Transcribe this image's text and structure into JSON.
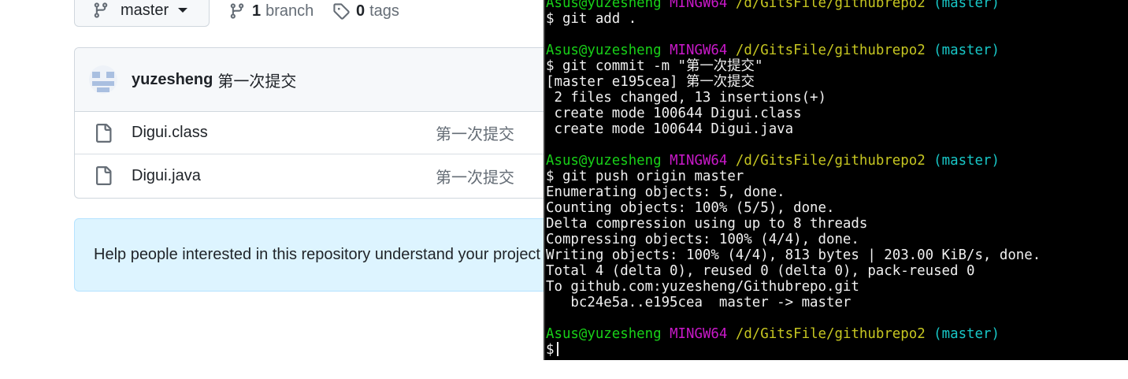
{
  "repo": {
    "branch_selector": {
      "label": "master",
      "icon": "git-branch-icon"
    },
    "branches": {
      "count": "1",
      "label": "branch",
      "icon": "git-branch-icon"
    },
    "tags": {
      "count": "0",
      "label": "tags",
      "icon": "tag-icon"
    },
    "latest_commit": {
      "author": "yuzesheng",
      "message": "第一次提交"
    },
    "files": [
      {
        "name": "Digui.class",
        "commit_message": "第一次提交",
        "icon": "file-icon"
      },
      {
        "name": "Digui.java",
        "commit_message": "第一次提交",
        "icon": "file-icon"
      }
    ],
    "readme_banner": {
      "text": "Help people interested in this repository understand your project"
    }
  },
  "terminal": {
    "colors": {
      "user": "#18d118",
      "shell": "#c919c9",
      "path": "#c6c621",
      "branch": "#18c6c6",
      "text": "#f0f0f0",
      "background": "#000000"
    },
    "prompt": {
      "user": "Asus@yuzesheng",
      "shell": "MINGW64",
      "path": "/d/GitsFile/githubrepo2",
      "branch": "(master)"
    },
    "lines": [
      {
        "kind": "prompt"
      },
      {
        "kind": "text",
        "text": "$ git add ."
      },
      {
        "kind": "text",
        "text": ""
      },
      {
        "kind": "prompt"
      },
      {
        "kind": "text",
        "text": "$ git commit -m \"第一次提交\""
      },
      {
        "kind": "text",
        "text": "[master e195cea] 第一次提交"
      },
      {
        "kind": "text",
        "text": " 2 files changed, 13 insertions(+)"
      },
      {
        "kind": "text",
        "text": " create mode 100644 Digui.class"
      },
      {
        "kind": "text",
        "text": " create mode 100644 Digui.java"
      },
      {
        "kind": "text",
        "text": ""
      },
      {
        "kind": "prompt"
      },
      {
        "kind": "text",
        "text": "$ git push origin master"
      },
      {
        "kind": "text",
        "text": "Enumerating objects: 5, done."
      },
      {
        "kind": "text",
        "text": "Counting objects: 100% (5/5), done."
      },
      {
        "kind": "text",
        "text": "Delta compression using up to 8 threads"
      },
      {
        "kind": "text",
        "text": "Compressing objects: 100% (4/4), done."
      },
      {
        "kind": "text",
        "text": "Writing objects: 100% (4/4), 813 bytes | 203.00 KiB/s, done."
      },
      {
        "kind": "text",
        "text": "Total 4 (delta 0), reused 0 (delta 0), pack-reused 0"
      },
      {
        "kind": "text",
        "text": "To github.com:yuzesheng/Githubrepo.git"
      },
      {
        "kind": "text",
        "text": "   bc24e5a..e195cea  master -> master"
      },
      {
        "kind": "text",
        "text": ""
      },
      {
        "kind": "prompt"
      },
      {
        "kind": "input",
        "text": "$"
      }
    ]
  }
}
